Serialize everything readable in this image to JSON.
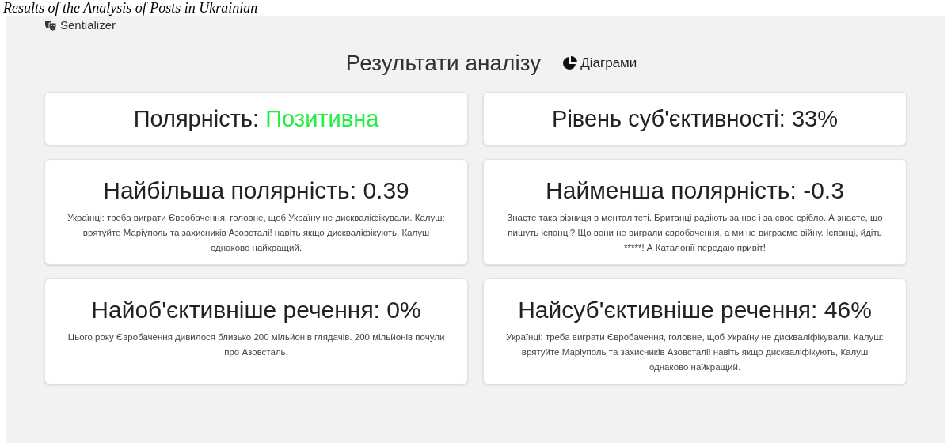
{
  "caption": "Results of the Analysis of Posts in Ukrainian",
  "brand": "Sentializer",
  "title": "Результати аналізу",
  "charts_link": "Діаграми",
  "cards": [
    {
      "kind": "summary",
      "label": "Полярність:",
      "value": "Позитивна",
      "color": "#22ee44"
    },
    {
      "kind": "summary",
      "label": "Рівень суб'єктивності:",
      "value": "33%"
    },
    {
      "kind": "detail",
      "label": "Найбільша полярність:",
      "value": "0.39",
      "text": "Українці: треба виграти Євробачення, головне, щоб Україну не дискваліфікували. Калуш: врятуйте Маріуполь та захисників Азовсталі! навіть якщо дискваліфікують, Калуш однаково найкращий."
    },
    {
      "kind": "detail",
      "label": "Найменша полярність:",
      "value": "-0.3",
      "text": "Знаєте така різниця в менталітеті. Британці радіють за нас і за своє срібло. А знаєте, що пишуть іспанці? Що вони не виграли євробачення, а ми не виграємо війну. Іспанці, йдіть *****! А Каталонії передаю привіт!"
    },
    {
      "kind": "detail",
      "label": "Найоб'єктивніше речення:",
      "value": "0%",
      "text": "Цього року Євробачення дивилося близько 200 мільйонів глядачів. 200 мільйонів почули про Азовсталь."
    },
    {
      "kind": "detail",
      "label": "Найсуб'єктивніше речення:",
      "value": "46%",
      "text": "Українці: треба виграти Євробачення, головне, щоб Україну не дискваліфікували. Калуш: врятуйте Маріуполь та захисників Азовсталі! навіть якщо дискваліфікують, Калуш однаково найкращий."
    }
  ]
}
